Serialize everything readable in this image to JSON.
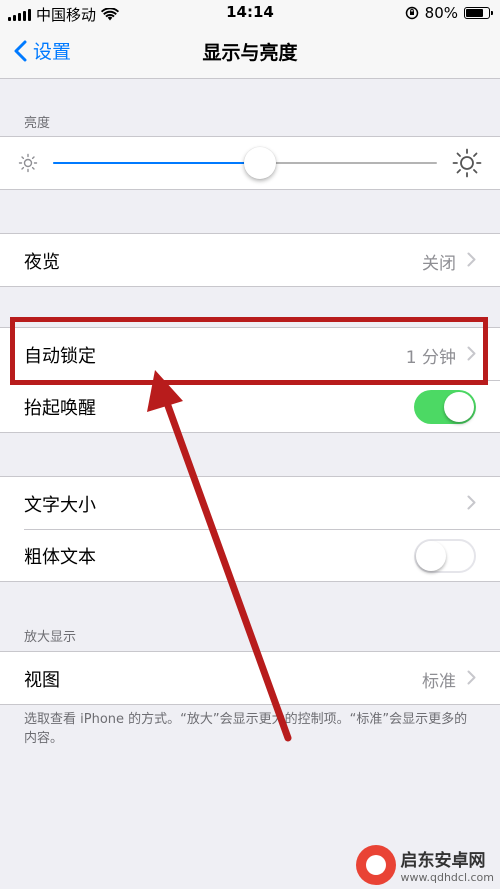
{
  "status_bar": {
    "carrier": "中国移动",
    "time": "14:14",
    "battery": "80%",
    "battery_level": 0.8
  },
  "nav": {
    "back_label": "设置",
    "title": "显示与亮度"
  },
  "brightness": {
    "header": "亮度",
    "level": 0.54
  },
  "night_shift": {
    "label": "夜览",
    "value": "关闭"
  },
  "auto_lock": {
    "label": "自动锁定",
    "value": "1 分钟"
  },
  "raise_to_wake": {
    "label": "抬起唤醒",
    "enabled": true
  },
  "text_size": {
    "label": "文字大小"
  },
  "bold_text": {
    "label": "粗体文本",
    "enabled": false
  },
  "zoom": {
    "header": "放大显示",
    "view_label": "视图",
    "view_value": "标准",
    "footer": "选取查看 iPhone 的方式。“放大”会显示更大的控制项。“标准”会显示更多的内容。"
  },
  "watermark": {
    "name": "启东安卓网",
    "url": "www.qdhdcl.com"
  },
  "colors": {
    "accent": "#007aff",
    "switch_on": "#4cd964",
    "annotation": "#b81c1c",
    "background": "#efeff4"
  }
}
